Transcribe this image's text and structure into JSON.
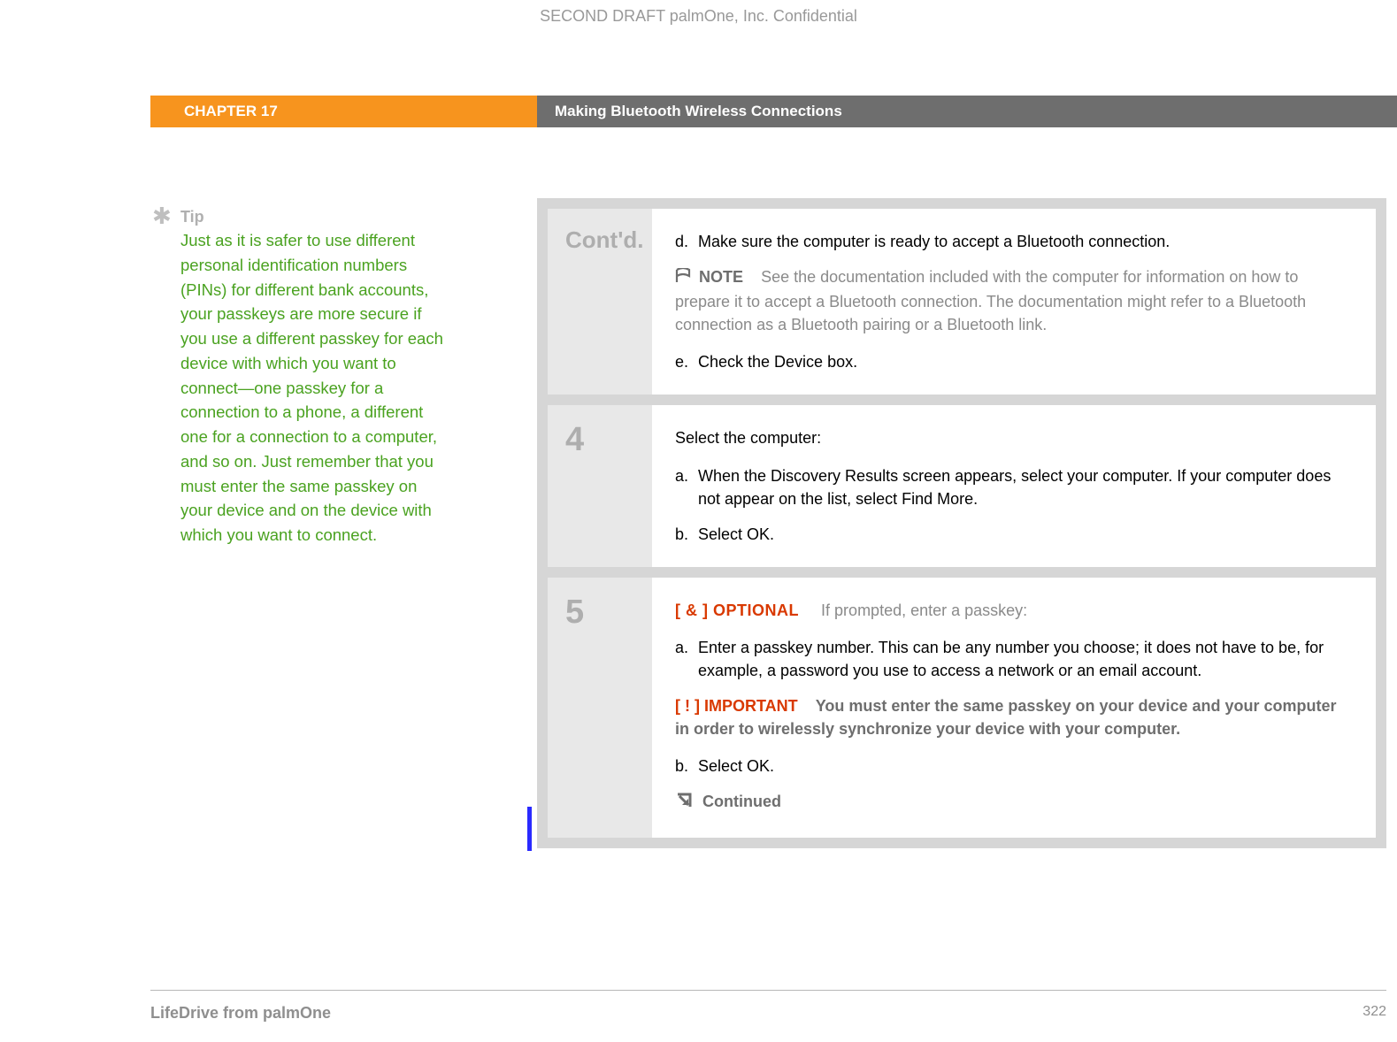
{
  "confidential": "SECOND DRAFT palmOne, Inc.  Confidential",
  "header": {
    "chapter": "CHAPTER 17",
    "title": "Making Bluetooth Wireless Connections"
  },
  "tip": {
    "label": "Tip",
    "body": "Just as it is safer to use different personal identification numbers (PINs) for different bank accounts, your passkeys are more secure if you use a different passkey for each device with which you want to connect—one passkey for a connection to a phone, a different one for a connection to a computer, and so on. Just remember that you must enter the same passkey on your device and on the device with which you want to connect."
  },
  "steps": {
    "contd": {
      "label": "Cont'd.",
      "d_letter": "d.",
      "d_text": "Make sure the computer is ready to accept a Bluetooth connection.",
      "note_label": "NOTE",
      "note_body": "See the documentation included with the computer for information on how to prepare it to accept a Bluetooth connection. The documentation might refer to a Bluetooth connection as a Bluetooth pairing or a Bluetooth link.",
      "e_letter": "e.",
      "e_text": "Check the Device box."
    },
    "four": {
      "num": "4",
      "intro": "Select the computer:",
      "a_letter": "a.",
      "a_text": "When the Discovery Results screen appears, select your computer. If your computer does not appear on the list, select Find More.",
      "b_letter": "b.",
      "b_text": "Select OK."
    },
    "five": {
      "num": "5",
      "optional_prefix": "[ & ]  OPTIONAL",
      "optional_body": "If prompted, enter a passkey:",
      "a_letter": "a.",
      "a_text": "Enter a passkey number. This can be any number you choose; it does not have to be, for example, a password you use to access a network or an email account.",
      "important_prefix": "[ ! ] IMPORTANT",
      "important_body": "You must enter the same passkey on your device and your computer in order to wirelessly synchronize your device with your computer.",
      "b_letter": "b.",
      "b_text": "Select OK.",
      "continued": "Continued"
    }
  },
  "footer": {
    "product": "LifeDrive from palmOne",
    "page": "322"
  }
}
